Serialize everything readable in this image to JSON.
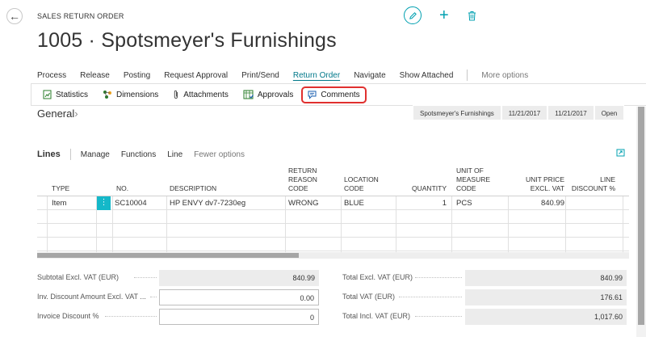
{
  "header": {
    "page_type": "SALES RETURN ORDER",
    "title": "1005 · Spotsmeyer's Furnishings"
  },
  "menu": {
    "items": [
      "Process",
      "Release",
      "Posting",
      "Request Approval",
      "Print/Send",
      "Return Order",
      "Navigate",
      "Show Attached"
    ],
    "more": "More options"
  },
  "actions": {
    "items": [
      "Statistics",
      "Dimensions",
      "Attachments",
      "Approvals",
      "Comments"
    ]
  },
  "general": {
    "title": "General",
    "chips": [
      "Spotsmeyer's Furnishings",
      "11/21/2017",
      "11/21/2017",
      "Open"
    ]
  },
  "lines": {
    "title": "Lines",
    "menu": [
      "Manage",
      "Functions",
      "Line"
    ],
    "fewer": "Fewer options",
    "columns": {
      "type": "TYPE",
      "no": "NO.",
      "description": "DESCRIPTION",
      "return_reason_1": "RETURN",
      "return_reason_2": "REASON",
      "return_reason_3": "CODE",
      "location_1": "LOCATION",
      "location_2": "CODE",
      "quantity": "QUANTITY",
      "uom_1": "UNIT OF",
      "uom_2": "MEASURE",
      "uom_3": "CODE",
      "price_1": "UNIT PRICE",
      "price_2": "EXCL. VAT",
      "disc_1": "LINE",
      "disc_2": "DISCOUNT %"
    },
    "rows": [
      {
        "type": "Item",
        "no": "SC10004",
        "description": "HP ENVY dv7-7230eg",
        "return_reason": "WRONG",
        "location": "BLUE",
        "quantity": "1",
        "uom": "PCS",
        "unit_price": "840.99"
      }
    ]
  },
  "totals": {
    "subtotal_label": "Subtotal Excl. VAT (EUR)",
    "subtotal": "840.99",
    "inv_disc_amount_label": "Inv. Discount Amount Excl. VAT ...",
    "inv_disc_amount": "0.00",
    "invoice_disc_pct_label": "Invoice Discount %",
    "invoice_disc_pct": "0",
    "total_excl_label": "Total Excl. VAT (EUR)",
    "total_excl": "840.99",
    "total_vat_label": "Total VAT (EUR)",
    "total_vat": "176.61",
    "total_incl_label": "Total Incl. VAT (EUR)",
    "total_incl": "1,017.60"
  },
  "icons": {
    "back": "back-arrow-icon",
    "edit": "pencil-icon",
    "new": "plus-icon",
    "delete": "trash-icon",
    "expand": "expand-icon"
  },
  "colors": {
    "accent": "#00a0b0",
    "highlight": "#e0302f",
    "row_menu": "#14b8c9"
  }
}
